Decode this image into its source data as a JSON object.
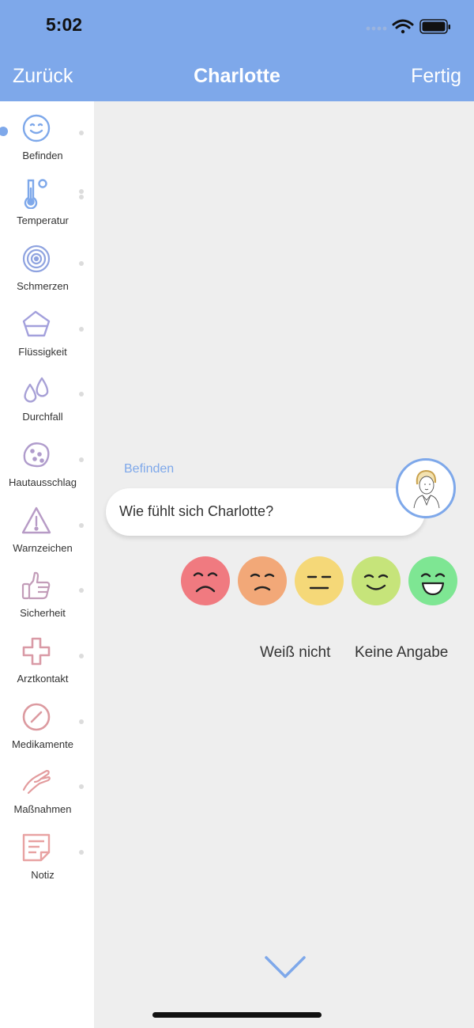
{
  "status": {
    "time": "5:02"
  },
  "nav": {
    "back": "Zurück",
    "title": "Charlotte",
    "done": "Fertig"
  },
  "sidebar": {
    "items": [
      {
        "label": "Befinden",
        "icon": "smile-icon",
        "color": "#7ea8ea"
      },
      {
        "label": "Temperatur",
        "icon": "thermometer-icon",
        "color": "#7ea8ea"
      },
      {
        "label": "Schmerzen",
        "icon": "target-icon",
        "color": "#8fa3e0"
      },
      {
        "label": "Flüssigkeit",
        "icon": "glass-icon",
        "color": "#a3a0dc"
      },
      {
        "label": "Durchfall",
        "icon": "drops-icon",
        "color": "#a7a0d6"
      },
      {
        "label": "Hautausschlag",
        "icon": "rash-icon",
        "color": "#b09ccc"
      },
      {
        "label": "Warnzeichen",
        "icon": "warning-icon",
        "color": "#b79bc6"
      },
      {
        "label": "Sicherheit",
        "icon": "thumbs-up-icon",
        "color": "#c29cb8"
      },
      {
        "label": "Arztkontakt",
        "icon": "cross-icon",
        "color": "#d99aa6"
      },
      {
        "label": "Medikamente",
        "icon": "pill-icon",
        "color": "#dc9aa0"
      },
      {
        "label": "Maßnahmen",
        "icon": "hand-icon",
        "color": "#e39c9e"
      },
      {
        "label": "Notiz",
        "icon": "note-icon",
        "color": "#e8a2a2"
      }
    ]
  },
  "chat": {
    "section_label": "Befinden",
    "question": "Wie fühlt sich Charlotte?",
    "moods": [
      {
        "name": "very-bad",
        "color": "#f07a80"
      },
      {
        "name": "bad",
        "color": "#f2a878"
      },
      {
        "name": "neutral",
        "color": "#f5d878"
      },
      {
        "name": "good",
        "color": "#c6e47a"
      },
      {
        "name": "very-good",
        "color": "#7ee693"
      }
    ],
    "option_unknown": "Weiß nicht",
    "option_no_answer": "Keine Angabe"
  }
}
